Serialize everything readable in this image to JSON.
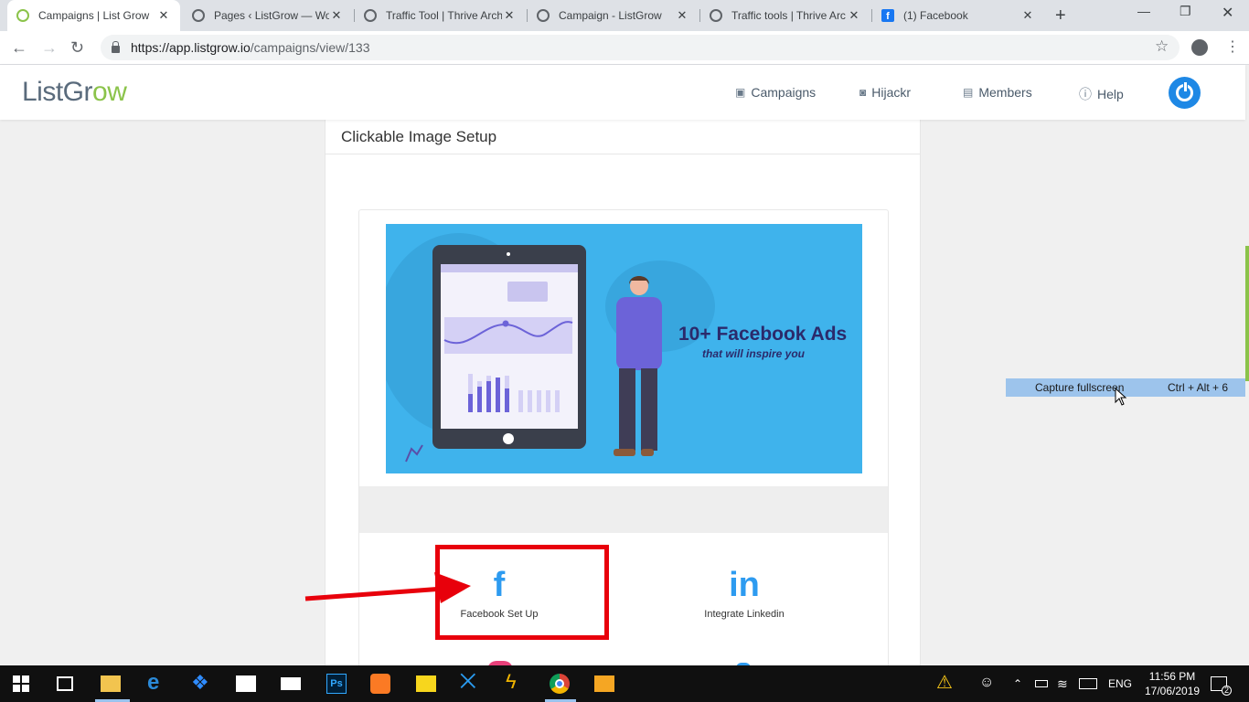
{
  "browser": {
    "tabs": [
      {
        "title": "Campaigns | List Grow",
        "active": true
      },
      {
        "title": "Pages ‹ ListGrow — Wo"
      },
      {
        "title": "Traffic Tool | Thrive Arch"
      },
      {
        "title": "Campaign - ListGrow"
      },
      {
        "title": "Traffic tools | Thrive Arc"
      },
      {
        "title": "(1) Facebook"
      }
    ],
    "url_host": "https://app.listgrow.io",
    "url_path": "/campaigns/view/133"
  },
  "app": {
    "logo_part1": "ListGr",
    "logo_part2": "ow",
    "nav": {
      "campaigns": "Campaigns",
      "hijackr": "Hijackr",
      "members": "Members",
      "help": "Help"
    }
  },
  "panel": {
    "title": "Clickable Image Setup",
    "banner_headline": "10+ Facebook Ads",
    "banner_sub": "that will inspire you",
    "facebook_label": "Facebook Set Up",
    "linkedin_label": "Integrate Linkedin",
    "facebook_glyph": "f",
    "linkedin_glyph": "in"
  },
  "tooltip": {
    "label": "Capture fullscreen",
    "shortcut": "Ctrl + Alt + 6"
  },
  "taskbar": {
    "lang": "ENG",
    "time": "11:56 PM",
    "date": "17/06/2019",
    "notifications": "2"
  },
  "colors": {
    "accent_blue": "#1e88e5",
    "logo_green": "#8bc34a",
    "banner_bg": "#3fb3ec",
    "highlight_red": "#e8000b"
  }
}
